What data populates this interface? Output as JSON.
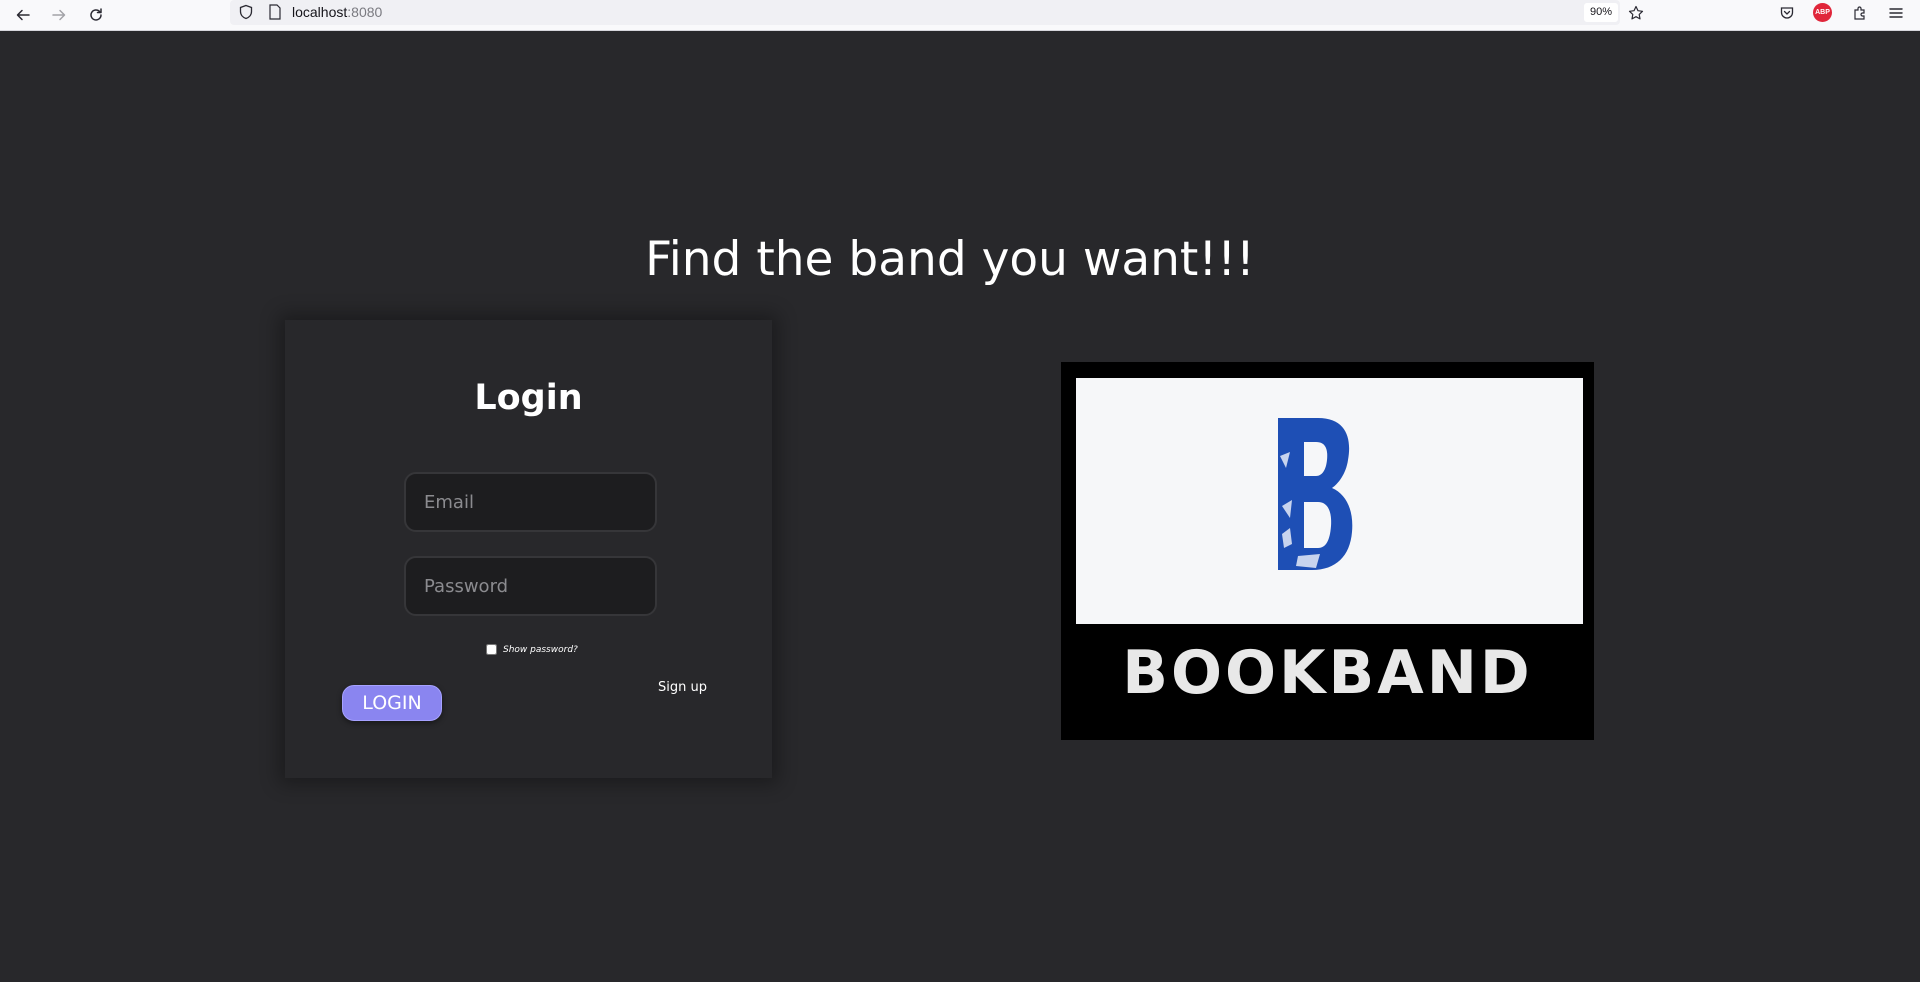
{
  "browser": {
    "url_host": "localhost",
    "url_port": ":8080",
    "zoom": "90%",
    "abp_label": "ABP",
    "icons": [
      "back-icon",
      "forward-icon",
      "reload-icon",
      "shield-icon",
      "page-icon",
      "bookmark-star-icon",
      "pocket-icon",
      "adblock-plus-icon",
      "extensions-icon",
      "menu-icon"
    ]
  },
  "page": {
    "headline": "Find the band you want!!!",
    "login": {
      "title": "Login",
      "email_placeholder": "Email",
      "password_placeholder": "Password",
      "show_password_label": "Show password?",
      "show_password_checked": false,
      "login_button": "LOGIN",
      "signup_link": "Sign up"
    },
    "logo": {
      "wordmark": "BOOKBAND",
      "b_color": "#1e4fb5"
    }
  },
  "colors": {
    "background": "#28282b",
    "accent": "#8a85f0"
  }
}
